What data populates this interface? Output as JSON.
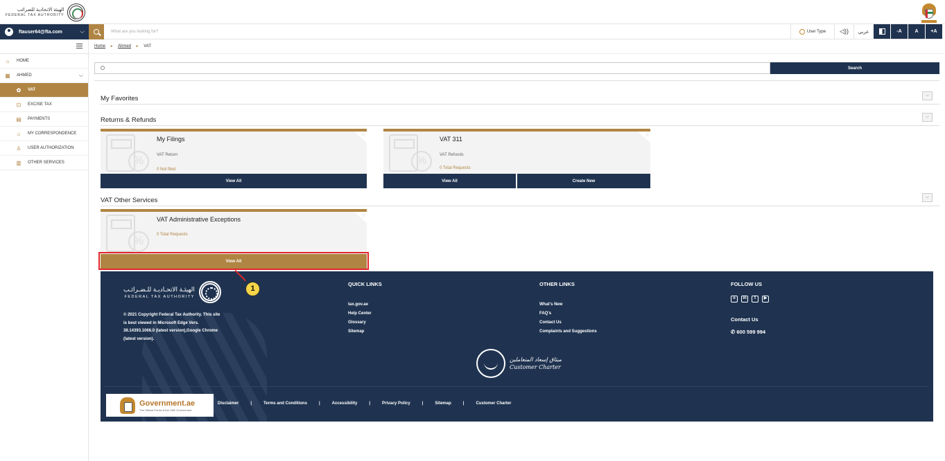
{
  "header": {
    "logo_ar": "الهيئة الاتحادية للضرائب",
    "logo_en": "FEDERAL TAX AUTHORITY"
  },
  "user": {
    "email": "ftauser64@fta.com"
  },
  "search_top": {
    "placeholder": "What are you looking for?"
  },
  "tools": {
    "user_type": "User Type",
    "speaker": "◁))",
    "arabic": "عربي",
    "decrease_font": "-A",
    "normal_font": "A",
    "increase_font": "+A"
  },
  "sidebar": {
    "items": [
      {
        "label": "HOME",
        "icon": "⌂"
      },
      {
        "label": "AHMED",
        "icon": "▦"
      },
      {
        "label": "VAT",
        "icon": "✿"
      },
      {
        "label": "EXCISE TAX",
        "icon": "⊡"
      },
      {
        "label": "PAYMENTS",
        "icon": "▤"
      },
      {
        "label": "MY CORRESPONDENCE",
        "icon": "⌂"
      },
      {
        "label": "USER AUTHORIZATION",
        "icon": "♙"
      },
      {
        "label": "OTHER SERVICES",
        "icon": "▥"
      }
    ]
  },
  "breadcrumb": {
    "home": "Home",
    "ahmed": "Ahmed",
    "current": "VAT",
    "sep": "►"
  },
  "main_search": {
    "button": "Search"
  },
  "sections": {
    "favorites": "My Favorites",
    "returns": "Returns & Refunds",
    "other": "VAT Other Services"
  },
  "cards": {
    "filings": {
      "title": "My Filings",
      "subtitle": "VAT Return",
      "count": "0 Not filed",
      "view": "View All"
    },
    "vat311": {
      "title": "VAT 311",
      "subtitle": "VAT Refunds",
      "count": "0 Total Requests",
      "view": "View All",
      "create": "Create New"
    },
    "exceptions": {
      "title": "VAT Administrative Exceptions",
      "count": "0 Total Requests",
      "view": "View All"
    }
  },
  "callout": {
    "number": "1"
  },
  "footer": {
    "logo_ar": "الهيئـة الاتحـاديـة للـضـرائـب",
    "logo_en": "FEDERAL TAX AUTHORITY",
    "copyright": "© 2021 Copyright Federal Tax Authority. This site is best viewed in Microsoft Edge Vers. 38.14393.1066.0 (latest version),Google Chrome (latest version).",
    "quick_links_title": "QUICK LINKS",
    "quick_links": [
      "tax.gov.ae",
      "Help Center",
      "Glossary",
      "Sitemap"
    ],
    "other_links_title": "OTHER LINKS",
    "other_links": [
      "What's New",
      "FAQ's",
      "Contact Us",
      "Complaints and Suggestions"
    ],
    "follow_title": "FOLLOW US",
    "contact_title": "Contact Us",
    "phone": "600 599 994",
    "charter_ar": "ميثاق إسعاد المتعاملين",
    "charter_en": "Customer Charter",
    "gov_name": "Government.ae",
    "gov_tag": "The Official Portal of the UAE Government",
    "bottom_links": [
      "Disclaimer",
      "Terms and Conditions",
      "Accessibility",
      "Privacy Policy",
      "Sitemap",
      "Customer Charter"
    ]
  },
  "colors": {
    "navy": "#1f3350",
    "gold": "#b08543",
    "highlight": "#e0262b"
  }
}
